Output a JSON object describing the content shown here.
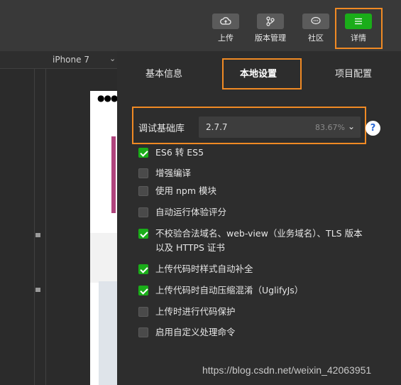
{
  "toolbar": {
    "buttons": [
      {
        "label": "上传",
        "icon": "cloud-upload-icon"
      },
      {
        "label": "版本管理",
        "icon": "branch-icon"
      },
      {
        "label": "社区",
        "icon": "chat-icon"
      },
      {
        "label": "详情",
        "icon": "menu-icon"
      }
    ]
  },
  "device": {
    "name": "iPhone 7"
  },
  "simulator": {
    "status": "●●●●"
  },
  "tabs": [
    "基本信息",
    "本地设置",
    "项目配置"
  ],
  "library": {
    "label": "调试基础库",
    "version": "2.7.7",
    "coverage": "83.67%",
    "help": "?"
  },
  "options": [
    {
      "label": "ES6 转 ES5",
      "checked": true
    },
    {
      "label": "增强编译",
      "checked": false
    },
    {
      "label": "使用 npm 模块",
      "checked": false
    },
    {
      "label": "自动运行体验评分",
      "checked": false
    },
    {
      "label": "不校验合法域名、web-view（业务域名）、TLS 版本以及 HTTPS 证书",
      "checked": true
    },
    {
      "label": "上传代码时样式自动补全",
      "checked": true
    },
    {
      "label": "上传代码时自动压缩混淆（UglifyJs）",
      "checked": true
    },
    {
      "label": "上传时进行代码保护",
      "checked": false
    },
    {
      "label": "启用自定义处理命令",
      "checked": false
    }
  ],
  "watermark": "https://blog.csdn.net/weixin_42063951",
  "colors": {
    "accent": "#1aad19",
    "highlight": "#f08a24"
  }
}
